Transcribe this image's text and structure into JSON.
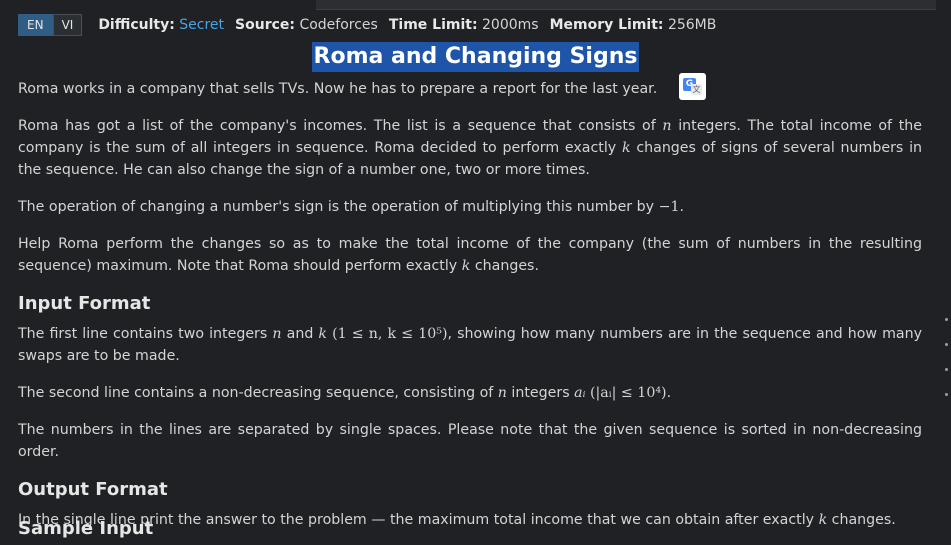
{
  "lang": {
    "en": "EN",
    "vi": "VI"
  },
  "meta": {
    "difficulty_label": "Difficulty:",
    "difficulty_value": "Secret",
    "source_label": "Source:",
    "source_value": "Codeforces",
    "time_label": "Time Limit:",
    "time_value": "2000ms",
    "memory_label": "Memory Limit:",
    "memory_value": "256MB"
  },
  "title": "Roma and Changing Signs",
  "statement": {
    "p1": "Roma works in a company that sells TVs. Now he has to prepare a report for the last year.",
    "p2a": "Roma has got a list of the company's incomes. The list is a sequence that consists of ",
    "p2b": " integers. The total income of the company is the sum of all integers in sequence. Roma decided to perform exactly ",
    "p2c": " changes of signs of several numbers in the sequence. He can also change the sign of a number one, two or more times.",
    "p3a": "The operation of changing a number's sign is the operation of multiplying this number by ",
    "p3b": ".",
    "p4a": "Help Roma perform the changes so as to make the total income of the company (the sum of numbers in the resulting sequence) maximum. Note that Roma should perform exactly ",
    "p4b": " changes."
  },
  "input": {
    "heading": "Input Format",
    "p1a": "The first line contains two integers ",
    "p1b": " and ",
    "p1c": ", showing how many numbers are in the sequence and how many swaps are to be made.",
    "p2a": "The second line contains a non-decreasing sequence, consisting of ",
    "p2b": " integers ",
    "p2c": ".",
    "p3": "The numbers in the lines are separated by single spaces. Please note that the given sequence is sorted in non-decreasing order."
  },
  "output": {
    "heading": "Output Format",
    "p1a": "In the single line print the answer to the problem — the maximum total income that we can obtain after exactly ",
    "p1b": " changes."
  },
  "next_heading": "Sample Input",
  "math": {
    "n": "n",
    "k": "k",
    "neg_one": "−1",
    "constraint1": "(1 ≤ n, k ≤ 10⁵)",
    "a_i": "aᵢ",
    "constraint2": "(|aᵢ| ≤ 10⁴)"
  }
}
